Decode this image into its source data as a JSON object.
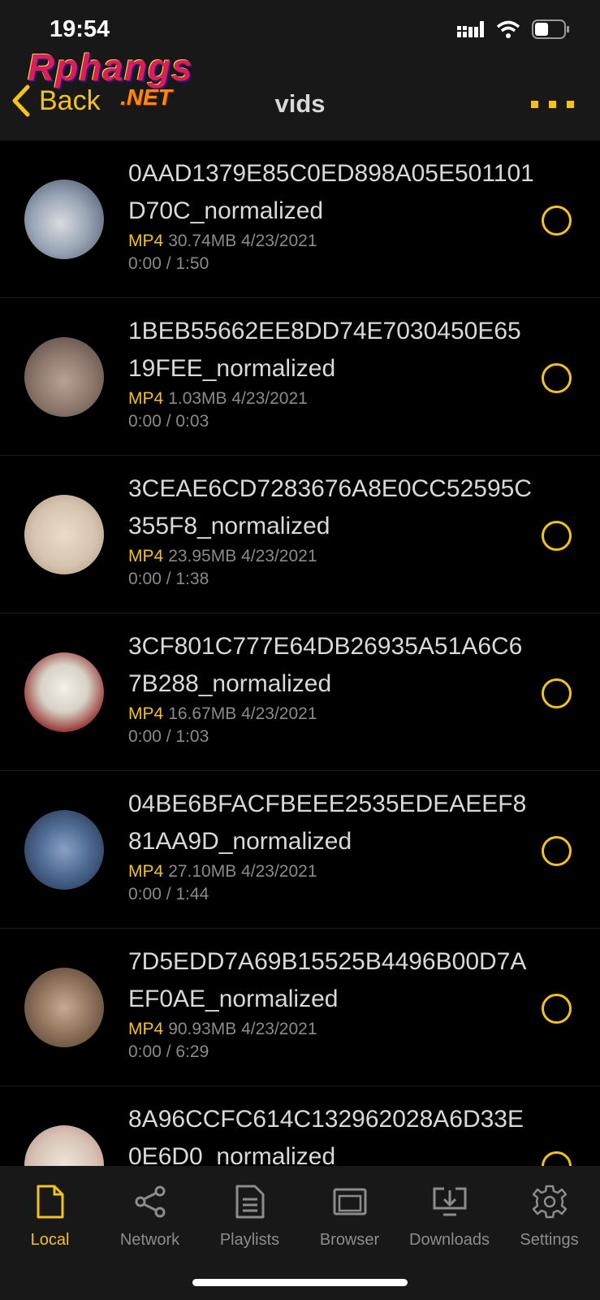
{
  "status": {
    "time": "19:54"
  },
  "watermark": {
    "line1": "Rphangs",
    "line2": ".NET"
  },
  "nav": {
    "back_label": "Back",
    "title": "vids"
  },
  "colors": {
    "accent": "#f3c21b",
    "background": "#000000",
    "bar": "#181818"
  },
  "videos": [
    {
      "name": "0AAD1379E85C0ED898A05E501101D70C_normalized",
      "format": "MP4",
      "size": "30.74MB",
      "date": "4/23/2021",
      "progress": "0:00 / 1:50"
    },
    {
      "name": "1BEB55662EE8DD74E7030450E6519FEE_normalized",
      "format": "MP4",
      "size": "1.03MB",
      "date": "4/23/2021",
      "progress": "0:00 / 0:03"
    },
    {
      "name": "3CEAE6CD7283676A8E0CC52595C355F8_normalized",
      "format": "MP4",
      "size": "23.95MB",
      "date": "4/23/2021",
      "progress": "0:00 / 1:38"
    },
    {
      "name": "3CF801C777E64DB26935A51A6C67B288_normalized",
      "format": "MP4",
      "size": "16.67MB",
      "date": "4/23/2021",
      "progress": "0:00 / 1:03"
    },
    {
      "name": "04BE6BFACFBEEE2535EDEAEEF881AA9D_normalized",
      "format": "MP4",
      "size": "27.10MB",
      "date": "4/23/2021",
      "progress": "0:00 / 1:44"
    },
    {
      "name": "7D5EDD7A69B15525B4496B00D7AEF0AE_normalized",
      "format": "MP4",
      "size": "90.93MB",
      "date": "4/23/2021",
      "progress": "0:00 / 6:29"
    },
    {
      "name": "8A96CCFC614C132962028A6D33E0E6D0_normalized",
      "format": "",
      "size": "",
      "date": "",
      "progress": ""
    }
  ],
  "tabs": [
    {
      "label": "Local",
      "icon": "document-icon"
    },
    {
      "label": "Network",
      "icon": "share-icon"
    },
    {
      "label": "Playlists",
      "icon": "playlist-icon"
    },
    {
      "label": "Browser",
      "icon": "browser-icon"
    },
    {
      "label": "Downloads",
      "icon": "download-icon"
    },
    {
      "label": "Settings",
      "icon": "gear-icon"
    }
  ]
}
